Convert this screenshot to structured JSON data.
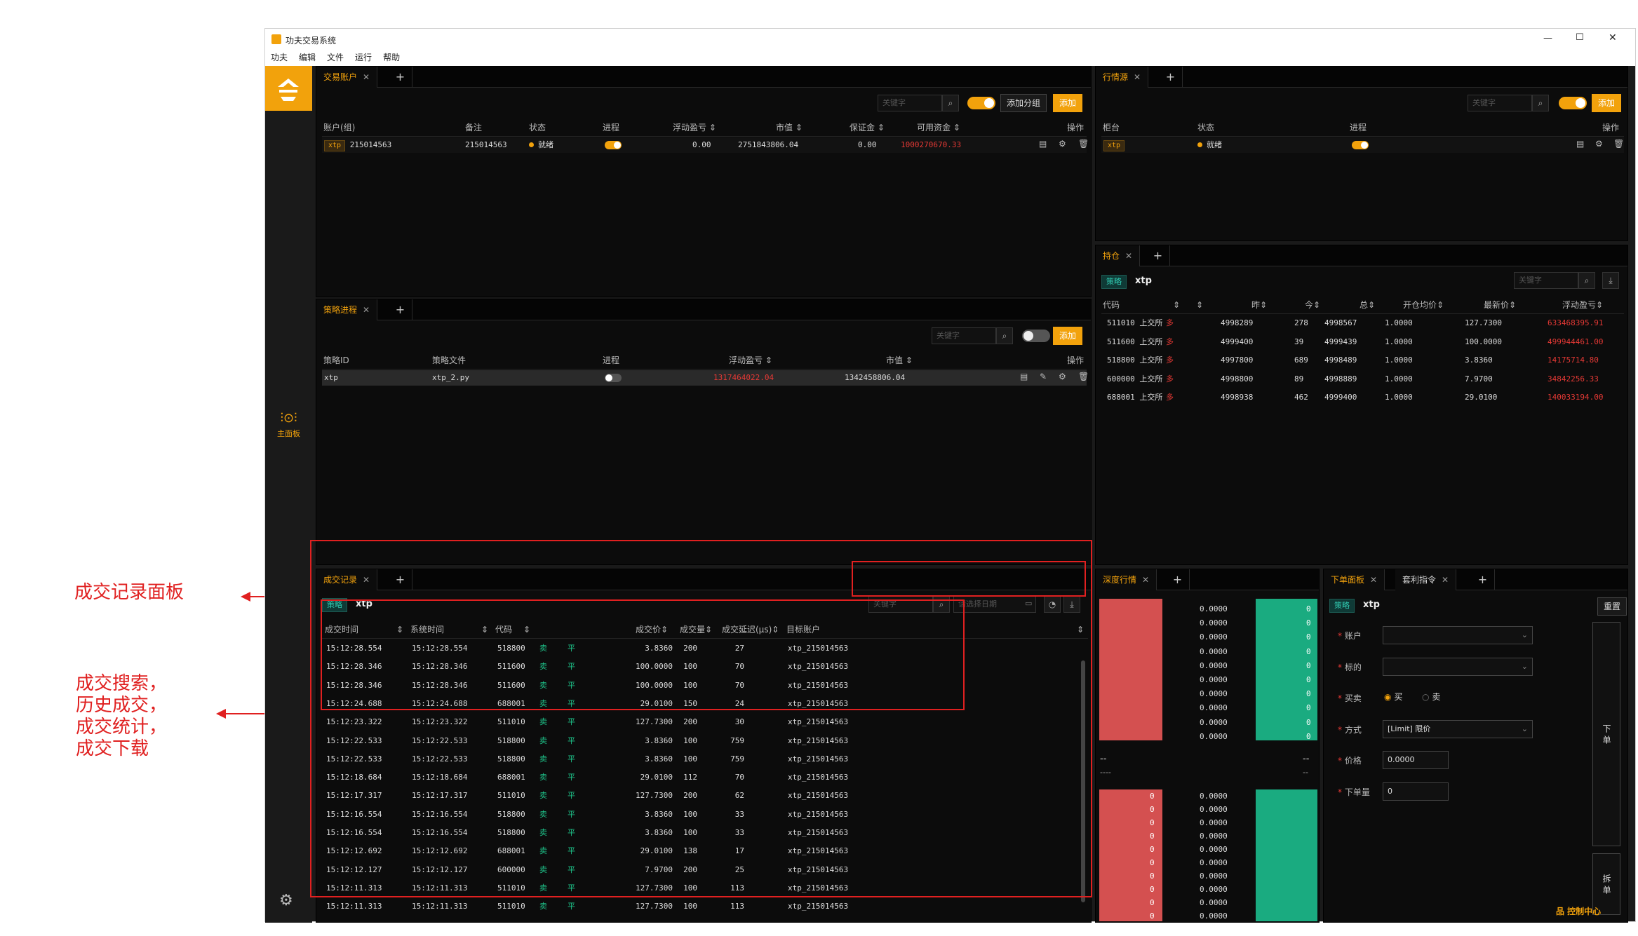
{
  "window": {
    "title": "功夫交易系统",
    "controls": [
      "—",
      "☐",
      "✕"
    ]
  },
  "menu": [
    "功夫",
    "编辑",
    "文件",
    "运行",
    "帮助"
  ],
  "sidebar": {
    "logo": "功夫",
    "main_panel_label": "主面板",
    "main_panel_icon": "sliders-icon",
    "settings_icon": "gear-icon"
  },
  "accounts_panel": {
    "tab": "交易账户",
    "search_placeholder": "关键字",
    "add_group_label": "添加分组",
    "add_label": "添加",
    "headers": [
      "账户(组)",
      "备注",
      "状态",
      "进程",
      "浮动盈亏 ⇕",
      "市值 ⇕",
      "保证金 ⇕",
      "可用资金 ⇕",
      "操作"
    ],
    "rows": [
      {
        "tag": "xtp",
        "account": "215014563",
        "note": "215014563",
        "status": "就绪",
        "pnl": "0.00",
        "market_value": "2751843806.04",
        "margin": "0.00",
        "available": "1000270670.33"
      }
    ]
  },
  "md_panel": {
    "tab": "行情源",
    "search_placeholder": "关键字",
    "add_label": "添加",
    "headers": [
      "柜台",
      "状态",
      "进程",
      "操作"
    ],
    "rows": [
      {
        "tag": "xtp",
        "status": "就绪"
      }
    ]
  },
  "strategy_panel": {
    "tab": "策略进程",
    "search_placeholder": "关键字",
    "add_label": "添加",
    "headers": [
      "策略ID",
      "策略文件",
      "进程",
      "浮动盈亏 ⇕",
      "市值 ⇕",
      "操作"
    ],
    "rows": [
      {
        "id": "xtp",
        "file": "xtp_2.py",
        "pnl": "1317464022.04",
        "market_value": "1342458806.04"
      }
    ]
  },
  "position_panel": {
    "tab": "持仓",
    "badge": "策略",
    "name": "xtp",
    "search_placeholder": "关键字",
    "headers": [
      "代码",
      "⇕",
      "⇕",
      "昨⇕",
      "今⇕",
      "总⇕",
      "开仓均价⇕",
      "最新价⇕",
      "浮动盈亏⇕"
    ],
    "rows": [
      {
        "code": "511010 上交所",
        "dir": "多",
        "yd": "4998289",
        "td": "278",
        "total": "4998567",
        "avg": "1.0000",
        "last": "127.7300",
        "pnl": "633468395.91"
      },
      {
        "code": "511600 上交所",
        "dir": "多",
        "yd": "4999400",
        "td": "39",
        "total": "4999439",
        "avg": "1.0000",
        "last": "100.0000",
        "pnl": "499944461.00"
      },
      {
        "code": "518800 上交所",
        "dir": "多",
        "yd": "4997800",
        "td": "689",
        "total": "4998489",
        "avg": "1.0000",
        "last": "3.8360",
        "pnl": "14175714.80"
      },
      {
        "code": "600000 上交所",
        "dir": "多",
        "yd": "4998800",
        "td": "89",
        "total": "4998889",
        "avg": "1.0000",
        "last": "7.9700",
        "pnl": "34842256.33"
      },
      {
        "code": "688001 上交所",
        "dir": "多",
        "yd": "4998938",
        "td": "462",
        "total": "4999400",
        "avg": "1.0000",
        "last": "29.0100",
        "pnl": "140033194.00"
      }
    ]
  },
  "trades_panel": {
    "tab": "成交记录",
    "badge": "策略",
    "name": "xtp",
    "search_placeholder": "关键字",
    "date_placeholder": "请选择日期",
    "headers": [
      "成交时间",
      "系统时间",
      "代码",
      "",
      "",
      "成交价⇕",
      "成交量⇕",
      "成交延迟(μs)⇕",
      "目标账户"
    ],
    "rows": [
      [
        "15:12:28.554",
        "15:12:28.554",
        "518800",
        "卖",
        "平",
        "3.8360",
        "200",
        "27",
        "xtp_215014563"
      ],
      [
        "15:12:28.346",
        "15:12:28.346",
        "511600",
        "卖",
        "平",
        "100.0000",
        "100",
        "70",
        "xtp_215014563"
      ],
      [
        "15:12:28.346",
        "15:12:28.346",
        "511600",
        "卖",
        "平",
        "100.0000",
        "100",
        "70",
        "xtp_215014563"
      ],
      [
        "15:12:24.688",
        "15:12:24.688",
        "688001",
        "卖",
        "平",
        "29.0100",
        "150",
        "24",
        "xtp_215014563"
      ],
      [
        "15:12:23.322",
        "15:12:23.322",
        "511010",
        "卖",
        "平",
        "127.7300",
        "200",
        "30",
        "xtp_215014563"
      ],
      [
        "15:12:22.533",
        "15:12:22.533",
        "518800",
        "卖",
        "平",
        "3.8360",
        "100",
        "759",
        "xtp_215014563"
      ],
      [
        "15:12:22.533",
        "15:12:22.533",
        "518800",
        "卖",
        "平",
        "3.8360",
        "100",
        "759",
        "xtp_215014563"
      ],
      [
        "15:12:18.684",
        "15:12:18.684",
        "688001",
        "卖",
        "平",
        "29.0100",
        "112",
        "70",
        "xtp_215014563"
      ],
      [
        "15:12:17.317",
        "15:12:17.317",
        "511010",
        "卖",
        "平",
        "127.7300",
        "200",
        "62",
        "xtp_215014563"
      ],
      [
        "15:12:16.554",
        "15:12:16.554",
        "518800",
        "卖",
        "平",
        "3.8360",
        "100",
        "33",
        "xtp_215014563"
      ],
      [
        "15:12:16.554",
        "15:12:16.554",
        "518800",
        "卖",
        "平",
        "3.8360",
        "100",
        "33",
        "xtp_215014563"
      ],
      [
        "15:12:12.692",
        "15:12:12.692",
        "688001",
        "卖",
        "平",
        "29.0100",
        "138",
        "17",
        "xtp_215014563"
      ],
      [
        "15:12:12.127",
        "15:12:12.127",
        "600000",
        "卖",
        "平",
        "7.9700",
        "200",
        "25",
        "xtp_215014563"
      ],
      [
        "15:12:11.313",
        "15:12:11.313",
        "511010",
        "卖",
        "平",
        "127.7300",
        "100",
        "113",
        "xtp_215014563"
      ],
      [
        "15:12:11.313",
        "15:12:11.313",
        "511010",
        "卖",
        "平",
        "127.7300",
        "100",
        "113",
        "xtp_215014563"
      ]
    ]
  },
  "depth_panel": {
    "tab": "深度行情",
    "ask_prices": [
      "0.0000",
      "0.0000",
      "0.0000",
      "0.0000",
      "0.0000",
      "0.0000",
      "0.0000",
      "0.0000",
      "0.0000",
      "0.0000"
    ],
    "ask_vols": [
      "0",
      "0",
      "0",
      "0",
      "0",
      "0",
      "0",
      "0",
      "0",
      "0"
    ],
    "mid_left": "--",
    "mid_right": "--",
    "mid_left2": "----",
    "mid_right2": "--",
    "bid_prices": [
      "0.0000",
      "0.0000",
      "0.0000",
      "0.0000",
      "0.0000",
      "0.0000",
      "0.0000",
      "0.0000",
      "0.0000",
      "0.0000"
    ],
    "bid_vols": [
      "0",
      "0",
      "0",
      "0",
      "0",
      "0",
      "0",
      "0",
      "0",
      "0"
    ]
  },
  "order_panel": {
    "tabs": [
      "下单面板",
      "套利指令"
    ],
    "badge": "策略",
    "name": "xtp",
    "reset": "重置",
    "labels": {
      "account": "账户",
      "instrument": "标的",
      "side": "买卖",
      "type": "方式",
      "price": "价格",
      "volume": "下单量"
    },
    "side_buy": "买",
    "side_sell": "卖",
    "type_value": "[Limit] 限价",
    "price_value": "0.0000",
    "volume_value": "0",
    "place_order": "下 单",
    "split_order": "拆 单"
  },
  "status_bar": {
    "control_center": "品 控制中心"
  },
  "annotations": {
    "trade_panel": "成交记录面板",
    "features": [
      "成交搜索，",
      "历史成交，",
      "成交统计，",
      "成交下载"
    ]
  },
  "colors": {
    "accent": "#f2a20c",
    "up": "#e53935",
    "down": "#1ec48a",
    "highlight_box": "#e02020"
  }
}
